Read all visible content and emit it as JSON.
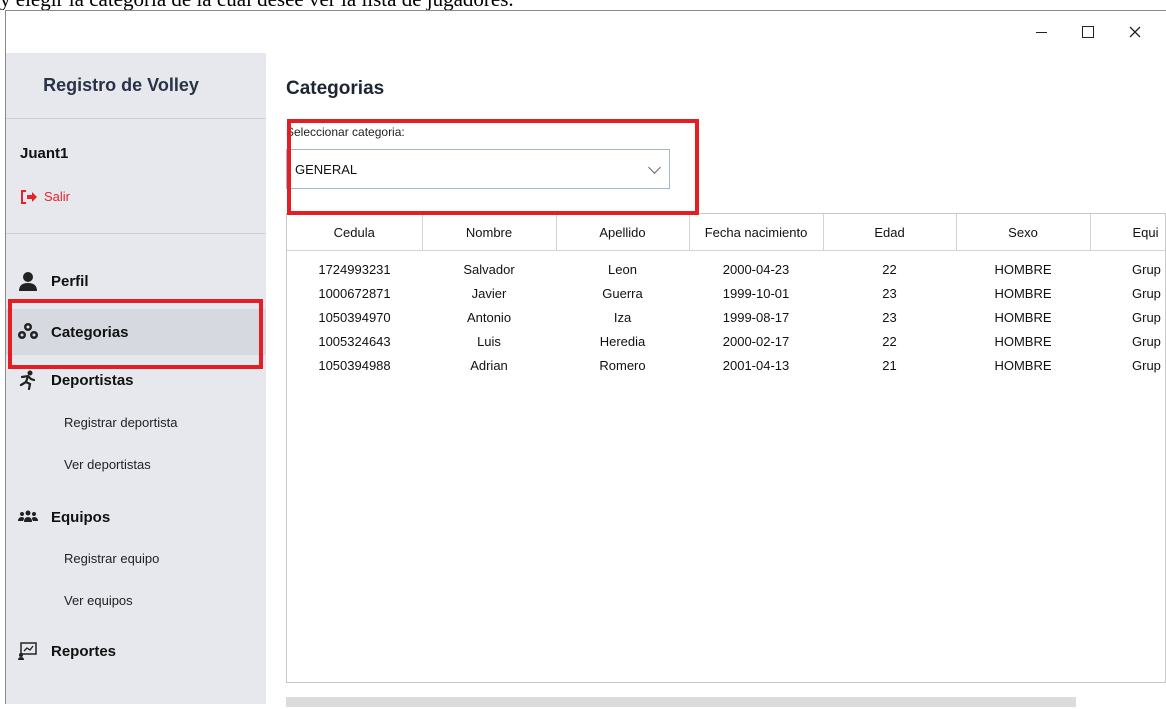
{
  "caption": "y elegir la categoria de la cual desee ver la lista de jugadores.",
  "sidebar": {
    "app_title": "Registro de Volley",
    "user": "Juant1",
    "logout_label": "Salir",
    "items": [
      {
        "label": "Perfil",
        "icon": "user-icon"
      },
      {
        "label": "Categorias",
        "icon": "users-group-icon",
        "active": true
      },
      {
        "label": "Deportistas",
        "icon": "runner-icon"
      },
      {
        "label": "Registrar deportista",
        "sub": true
      },
      {
        "label": "Ver deportistas",
        "sub": true
      },
      {
        "label": "Equipos",
        "icon": "team-icon"
      },
      {
        "label": "Registrar equipo",
        "sub": true
      },
      {
        "label": "Ver equipos",
        "sub": true
      },
      {
        "label": "Reportes",
        "icon": "report-icon"
      }
    ]
  },
  "main": {
    "title": "Categorias",
    "select_label": "Seleccionar categoria:",
    "select_value": "GENERAL",
    "table": {
      "columns": [
        "Cedula",
        "Nombre",
        "Apellido",
        "Fecha nacimiento",
        "Edad",
        "Sexo",
        "Equi"
      ],
      "rows": [
        [
          "1724993231",
          "Salvador",
          "Leon",
          "2000-04-23",
          "22",
          "HOMBRE",
          "Grup"
        ],
        [
          "1000672871",
          "Javier",
          "Guerra",
          "1999-10-01",
          "23",
          "HOMBRE",
          "Grup"
        ],
        [
          "1050394970",
          "Antonio",
          "Iza",
          "1999-08-17",
          "23",
          "HOMBRE",
          "Grup"
        ],
        [
          "1005324643",
          "Luis",
          "Heredia",
          "2000-02-17",
          "22",
          "HOMBRE",
          "Grup"
        ],
        [
          "1050394988",
          "Adrian",
          "Romero",
          "2001-04-13",
          "21",
          "HOMBRE",
          "Grup"
        ]
      ]
    }
  },
  "colors": {
    "highlight": "#e41e25",
    "sidebar_bg": "#e6e8ee",
    "logout": "#e2252a"
  }
}
